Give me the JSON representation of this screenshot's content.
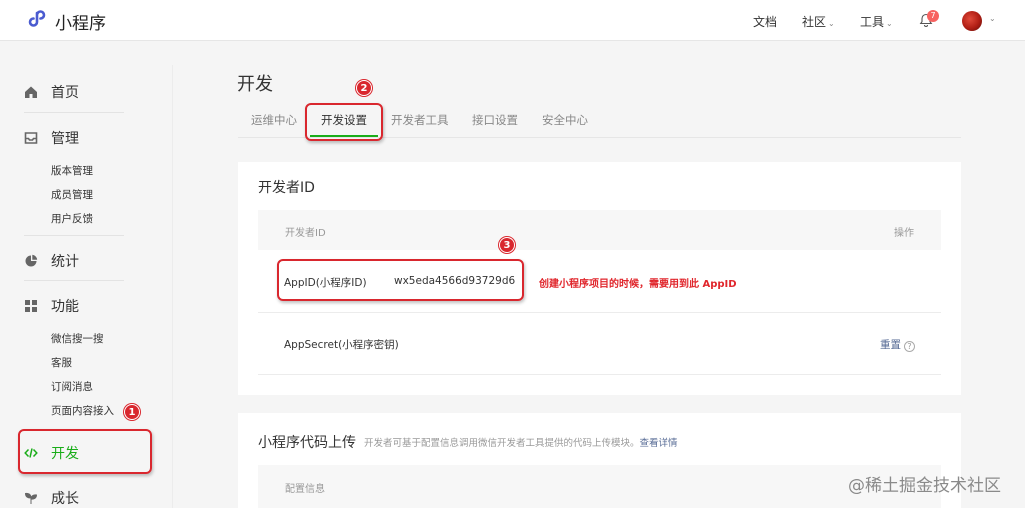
{
  "header": {
    "brand": "小程序",
    "nav": [
      {
        "label": "文档",
        "has_caret": false
      },
      {
        "label": "社区",
        "has_caret": true
      },
      {
        "label": "工具",
        "has_caret": true
      }
    ],
    "notification_count": "7",
    "caret": "⌄"
  },
  "sidebar": {
    "home": "首页",
    "manage": "管理",
    "manage_items": [
      "版本管理",
      "成员管理",
      "用户反馈"
    ],
    "stats": "统计",
    "features": "功能",
    "feature_items": [
      "微信搜一搜",
      "客服",
      "订阅消息",
      "页面内容接入"
    ],
    "develop": "开发",
    "grow": "成长",
    "active_color": "#1aad19"
  },
  "main": {
    "title": "开发",
    "tabs": [
      "运维中心",
      "开发设置",
      "开发者工具",
      "接口设置",
      "安全中心"
    ],
    "active_tab": 1,
    "developer_id": {
      "title": "开发者ID",
      "col_name": "开发者ID",
      "col_action": "操作",
      "appid_label": "AppID(小程序ID)",
      "appid_value": "wx5eda4566d93729d6",
      "appsecret_label": "AppSecret(小程序密钥)",
      "reset": "重置",
      "help": "?"
    },
    "code_upload": {
      "title": "小程序代码上传",
      "desc": "开发者可基于配置信息调用微信开发者工具提供的代码上传模块。",
      "link": "查看详情",
      "col_config": "配置信息"
    }
  },
  "annotations": {
    "n1": "1",
    "n2": "2",
    "n3": "3",
    "note": "创建小程序项目的时候，需要用到此 AppID",
    "color": "#d9272e"
  },
  "watermark": "@稀土掘金技术社区"
}
